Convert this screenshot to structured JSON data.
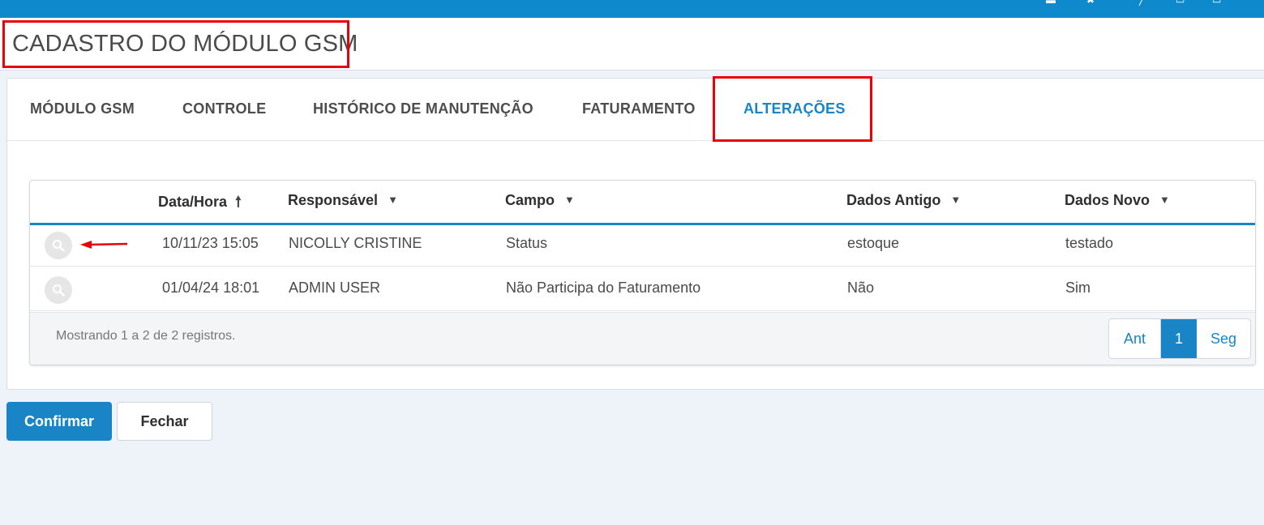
{
  "header": {
    "title": "CADASTRO DO MÓDULO GSM"
  },
  "topbar": {
    "icons": [
      "list-icon",
      "star-icon",
      "bell-icon",
      "user-icon",
      "menu-icon"
    ]
  },
  "tabs": [
    {
      "label": "MÓDULO GSM",
      "active": false
    },
    {
      "label": "CONTROLE",
      "active": false
    },
    {
      "label": "HISTÓRICO DE MANUTENÇÃO",
      "active": false
    },
    {
      "label": "FATURAMENTO",
      "active": false
    },
    {
      "label": "ALTERAÇÕES",
      "active": true
    }
  ],
  "table": {
    "columns": [
      "Data/Hora",
      "Responsável",
      "Campo",
      "Dados Antigo",
      "Dados Novo"
    ],
    "sorted_column": "Data/Hora",
    "rows": [
      {
        "datahora": "10/11/23 15:05",
        "responsavel": "NICOLLY CRISTINE",
        "campo": "Status",
        "antigo": "estoque",
        "novo": "testado"
      },
      {
        "datahora": "01/04/24 18:01",
        "responsavel": "ADMIN USER",
        "campo": "Não Participa do Faturamento",
        "antigo": "Não",
        "novo": "Sim"
      }
    ],
    "footer_info": "Mostrando 1 a 2 de 2 registros.",
    "pagination": {
      "prev": "Ant",
      "current": "1",
      "next": "Seg"
    }
  },
  "actions": {
    "confirm": "Confirmar",
    "close": "Fechar"
  },
  "colors": {
    "accent": "#1985c6",
    "topbar": "#0e89cc",
    "highlight": "#e8000b"
  }
}
